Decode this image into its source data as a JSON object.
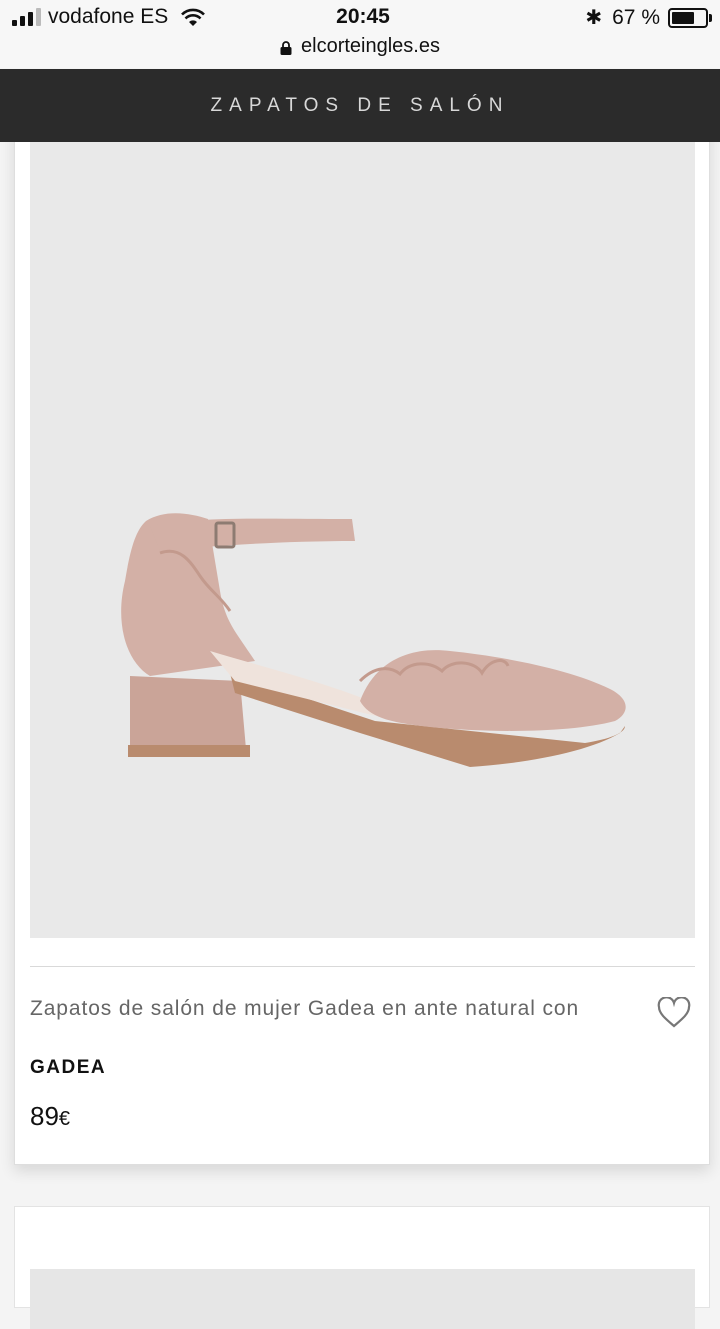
{
  "status_bar": {
    "carrier": "vodafone ES",
    "time": "20:45",
    "battery_pct": "67 %",
    "url": "elcorteingles.es"
  },
  "header": {
    "title": "ZAPATOS DE SALÓN"
  },
  "product": {
    "title": "Zapatos de salón de mujer Gadea en ante natural con",
    "brand": "GADEA",
    "price": "89",
    "currency": "€",
    "favorite_icon": "heart-outline-icon",
    "image_background": "#e9e9e9",
    "shoe_color": "#d3b0a6"
  },
  "colors": {
    "header_bg": "#2b2b2b",
    "header_text": "#d8d8d8"
  }
}
